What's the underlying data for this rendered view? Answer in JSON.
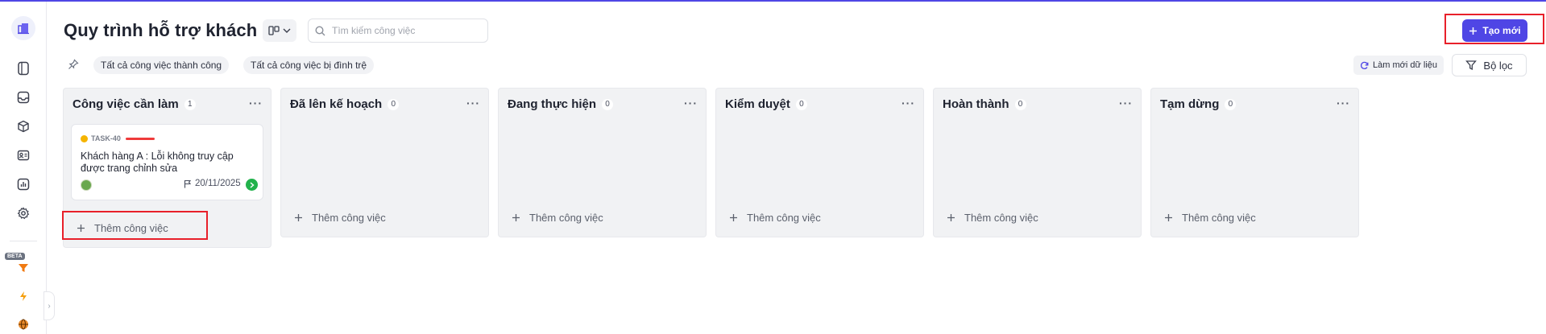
{
  "page": {
    "title": "Quy trình hỗ trợ khách",
    "search_placeholder": "Tìm kiếm công việc",
    "new_button": "Tạo mới",
    "refresh_button": "Làm mới dữ liệu",
    "filter_button": "Bộ lọc",
    "beta_badge": "BETA"
  },
  "filters": {
    "chips": [
      "Tất cả công việc thành công",
      "Tất cả công việc bị đình trệ"
    ]
  },
  "columns": [
    {
      "title": "Công việc cần làm",
      "count": "1",
      "add_label": "Thêm công việc",
      "cards": [
        {
          "task_id": "TASK-40",
          "title": "Khách hàng A : Lỗi không truy cập được trang chỉnh sửa",
          "date": "20/11/2025"
        }
      ]
    },
    {
      "title": "Đã lên kế hoạch",
      "count": "0",
      "add_label": "Thêm công việc",
      "cards": []
    },
    {
      "title": "Đang thực hiện",
      "count": "0",
      "add_label": "Thêm công việc",
      "cards": []
    },
    {
      "title": "Kiểm duyệt",
      "count": "0",
      "add_label": "Thêm công việc",
      "cards": []
    },
    {
      "title": "Hoàn thành",
      "count": "0",
      "add_label": "Thêm công việc",
      "cards": []
    },
    {
      "title": "Tạm dừng",
      "count": "0",
      "add_label": "Thêm công việc",
      "cards": []
    }
  ],
  "sidebar": {
    "icons": [
      "building-icon",
      "document-icon",
      "inbox-icon",
      "box-icon",
      "contact-card-icon",
      "bar-chart-icon",
      "settings-icon",
      "funnel-icon",
      "lightning-icon",
      "globe-icon"
    ]
  },
  "colors": {
    "accent": "#4f46e5",
    "highlight_frame": "#e8202a",
    "column_bg": "#f1f2f4",
    "priority_high": "#ef3b3b",
    "status_dot": "#f5b400",
    "go_button": "#22b24c"
  }
}
